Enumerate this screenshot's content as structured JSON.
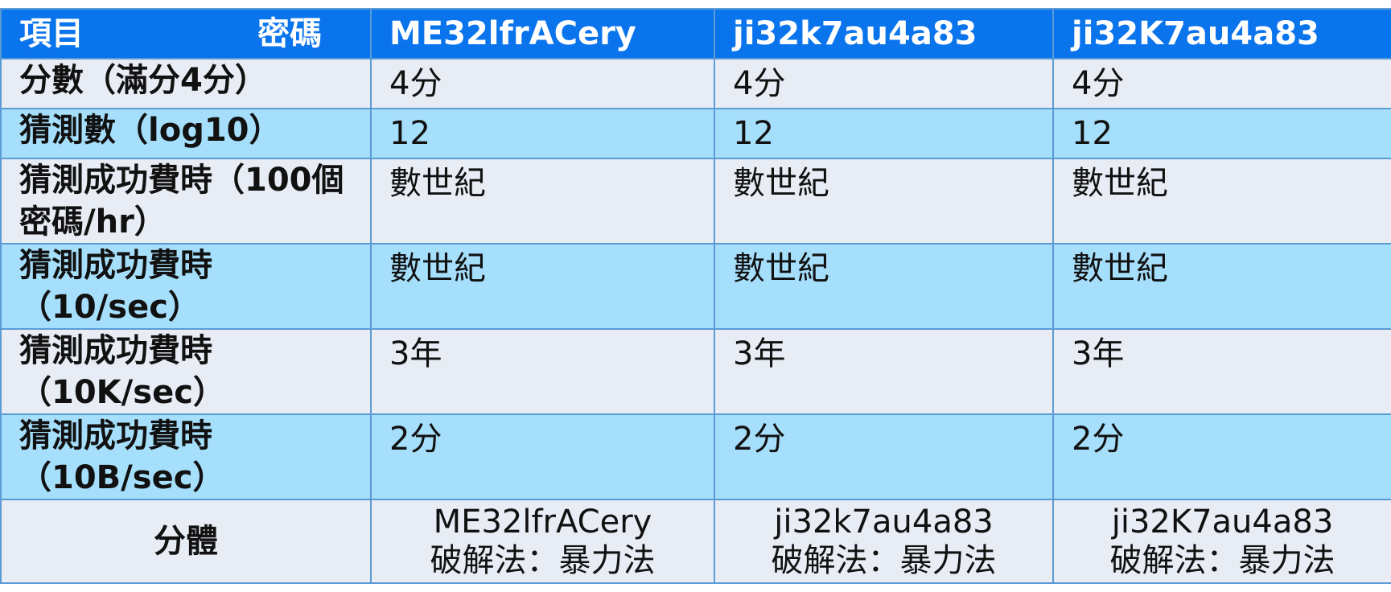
{
  "header": {
    "item": "項目",
    "password": "密碼",
    "columns": [
      "ME32lfrACery",
      "ji32k7au4a83",
      "ji32K7au4a83"
    ]
  },
  "rows": [
    {
      "label": "分數（滿分4分）",
      "values": [
        "4分",
        "4分",
        "4分"
      ]
    },
    {
      "label": "猜測數（log10）",
      "values": [
        "12",
        "12",
        "12"
      ]
    },
    {
      "label_line1": "猜測成功費時（100個",
      "label_line2": "密碼/hr）",
      "values": [
        "數世紀",
        "數世紀",
        "數世紀"
      ]
    },
    {
      "label_line1": "猜測成功費時",
      "label_line2": "（10/sec）",
      "values": [
        "數世紀",
        "數世紀",
        "數世紀"
      ]
    },
    {
      "label_line1": "猜測成功費時",
      "label_line2": "（10K/sec）",
      "values": [
        "3年",
        "3年",
        "3年"
      ]
    },
    {
      "label_line1": "猜測成功費時",
      "label_line2": "（10B/sec）",
      "values": [
        "2分",
        "2分",
        "2分"
      ]
    }
  ],
  "footer": {
    "label": "分體",
    "cells": [
      {
        "name": "ME32lfrACery",
        "method": "破解法：暴力法"
      },
      {
        "name": "ji32k7au4a83",
        "method": "破解法：暴力法"
      },
      {
        "name": "ji32K7au4a83",
        "method": "破解法：暴力法"
      }
    ]
  },
  "colors": {
    "header_bg": "#0a74ec",
    "row_light": "#e8edf5",
    "row_blue": "#a6dffb",
    "border": "#5b9bd5"
  }
}
